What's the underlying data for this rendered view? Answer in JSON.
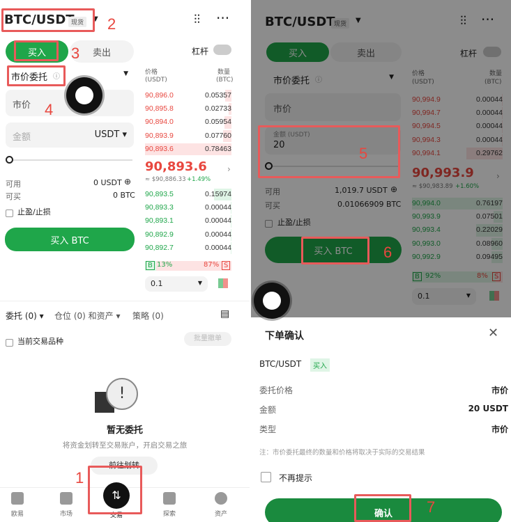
{
  "left": {
    "pair": "BTC/USDT",
    "pair_badge": "现货",
    "buy_tab": "买入",
    "sell_tab": "卖出",
    "leverage": "杠杆",
    "order_type": "市价委托",
    "price_placeholder": "市价",
    "amount_placeholder": "金额",
    "amount_unit": "USDT ▾",
    "available_label": "可用",
    "available_value": "0 USDT",
    "buyable_label": "可买",
    "buyable_value": "0 BTC",
    "tpsl": "止盈/止损",
    "buy_button": "买入 BTC",
    "ob_header_price": "价格",
    "ob_header_price_unit": "(USDT)",
    "ob_header_qty": "数量",
    "ob_header_qty_unit": "(BTC)",
    "asks": [
      [
        "90,896.0",
        "0.05357"
      ],
      [
        "90,895.8",
        "0.02733"
      ],
      [
        "90,894.0",
        "0.05954"
      ],
      [
        "90,893.9",
        "0.07760"
      ],
      [
        "90,893.6",
        "0.78463"
      ]
    ],
    "last_price": "90,893.6",
    "last_sub": "≈ $90,886.33",
    "last_change": "+1.49%",
    "bids": [
      [
        "90,893.5",
        "0.15974"
      ],
      [
        "90,893.3",
        "0.00044"
      ],
      [
        "90,893.1",
        "0.00044"
      ],
      [
        "90,892.9",
        "0.00044"
      ],
      [
        "90,892.7",
        "0.00044"
      ]
    ],
    "ratio_b": "B",
    "ratio_b_pct": "13%",
    "ratio_s_pct": "87%",
    "ratio_s": "S",
    "depth": "0.1",
    "tabs": [
      "委托 (0) ▾",
      "仓位 (0) 和资产 ▾",
      "策略 (0)"
    ],
    "current_only": "当前交易品种",
    "batch_cancel": "批量撤单",
    "empty_title": "暂无委托",
    "empty_sub": "将资金划转至交易账户，开启交易之旅",
    "transfer_btn": "前往划转",
    "nav": [
      "欧易",
      "市场",
      "交易",
      "探索",
      "资产"
    ]
  },
  "right": {
    "pair": "BTC/USDT",
    "pair_badge": "现货",
    "buy_tab": "买入",
    "sell_tab": "卖出",
    "leverage": "杠杆",
    "order_type": "市价委托",
    "price_placeholder": "市价",
    "amount_label": "金额 (USDT)",
    "amount_value": "20",
    "available_label": "可用",
    "available_value": "1,019.7 USDT",
    "buyable_label": "可买",
    "buyable_value": "0.01066909 BTC",
    "tpsl": "止盈/止损",
    "buy_button": "买入 BTC",
    "ob_header_price": "价格",
    "ob_header_price_unit": "(USDT)",
    "ob_header_qty": "数量",
    "ob_header_qty_unit": "(BTC)",
    "asks": [
      [
        "90,994.9",
        "0.00044"
      ],
      [
        "90,994.7",
        "0.00044"
      ],
      [
        "90,994.5",
        "0.00044"
      ],
      [
        "90,994.3",
        "0.00044"
      ],
      [
        "90,994.1",
        "0.29762"
      ]
    ],
    "last_price": "90,993.9",
    "last_sub": "≈ $90,983.89",
    "last_change": "+1.60%",
    "bids": [
      [
        "90,994.0",
        "0.76197"
      ],
      [
        "90,993.9",
        "0.07501"
      ],
      [
        "90,993.4",
        "0.22029"
      ],
      [
        "90,993.0",
        "0.08960"
      ],
      [
        "90,992.9",
        "0.09495"
      ]
    ],
    "ratio_b": "B",
    "ratio_b_pct": "92%",
    "ratio_s_pct": "8%",
    "ratio_s": "S",
    "depth": "0.1",
    "confirm_title": "下单确认",
    "confirm_pair": "BTC/USDT",
    "confirm_side": "买入",
    "rows": [
      [
        "委托价格",
        "市价"
      ],
      [
        "金额",
        "20 USDT"
      ],
      [
        "类型",
        "市价"
      ]
    ],
    "note": "注：市价委托最终的数量和价格将取决于实际的交易结果",
    "dont_remind": "不再提示",
    "confirm_btn": "确认"
  },
  "steps": [
    "1",
    "2",
    "3",
    "4",
    "5",
    "6",
    "7"
  ],
  "colors": {
    "green": "#1fa64a",
    "red": "#e8473f",
    "annotation": "#e85a5a"
  },
  "ask_fill": [
    0.07,
    0.035,
    0.08,
    0.1,
    1.0
  ],
  "bid_fill": [
    0.2,
    0.01,
    0.01,
    0.01,
    0.01
  ],
  "ask_fill_r": [
    0.01,
    0.01,
    0.01,
    0.01,
    0.4
  ],
  "bid_fill_r": [
    1.0,
    0.1,
    0.29,
    0.12,
    0.12
  ]
}
